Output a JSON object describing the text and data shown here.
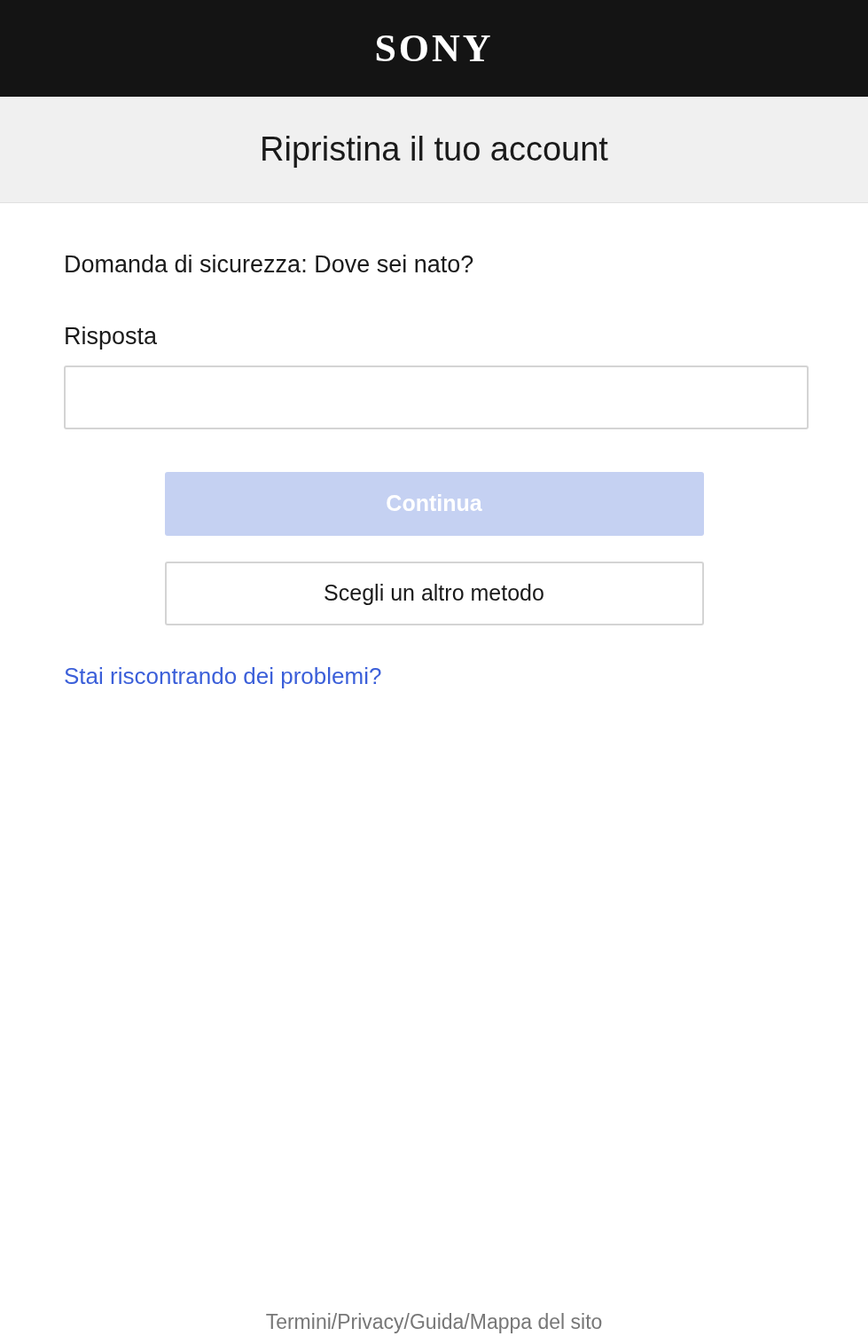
{
  "header": {
    "logo": "SONY"
  },
  "title": "Ripristina il tuo account",
  "question": "Domanda di sicurezza: Dove sei nato?",
  "answer_field": {
    "label": "Risposta"
  },
  "buttons": [
    {
      "label": "Continua",
      "kind": "primary",
      "disabled": true
    },
    {
      "label": "Scegli un altro metodo",
      "kind": "secondary",
      "disabled": false
    }
  ],
  "help_link": "Stai riscontrando dei problemi?",
  "footer": {
    "separator": "/",
    "links": [
      "Termini",
      "Privacy",
      "Guida",
      "Mappa del sito"
    ]
  }
}
